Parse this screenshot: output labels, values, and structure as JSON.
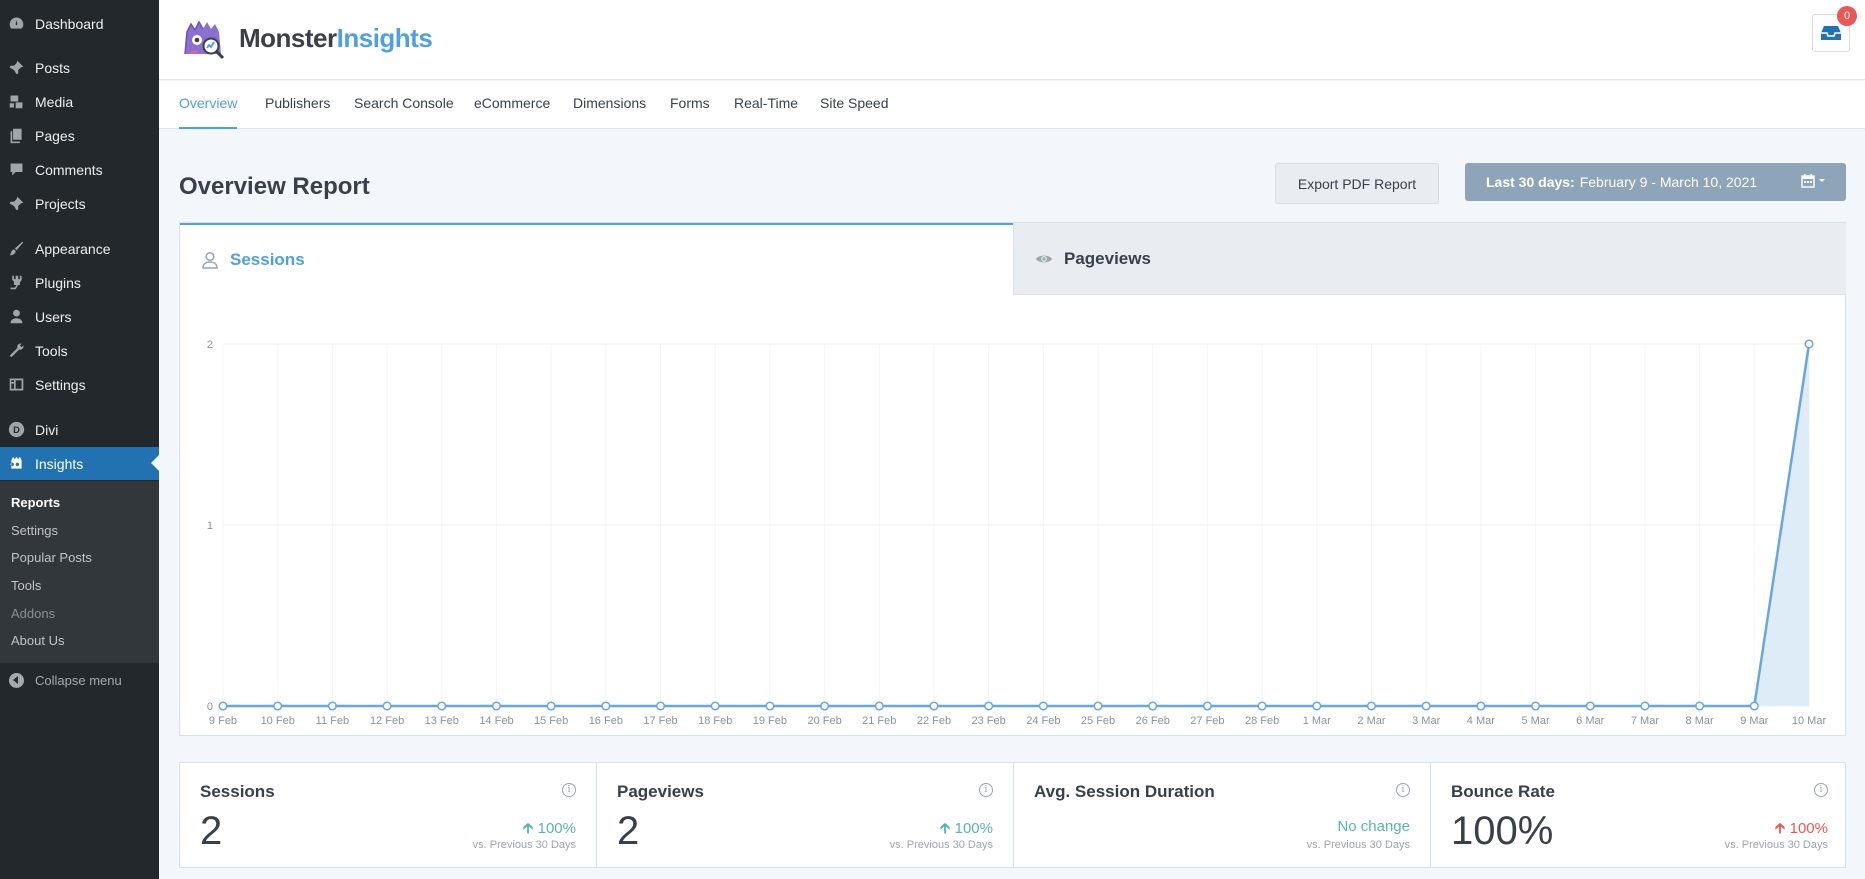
{
  "sidebar": {
    "items": [
      {
        "label": "Dashboard",
        "icon": "dashboard-icon"
      },
      {
        "label": "Posts",
        "icon": "pin-icon"
      },
      {
        "label": "Media",
        "icon": "media-icon"
      },
      {
        "label": "Pages",
        "icon": "pages-icon"
      },
      {
        "label": "Comments",
        "icon": "comment-icon"
      },
      {
        "label": "Projects",
        "icon": "pin-icon"
      },
      {
        "label": "Appearance",
        "icon": "brush-icon"
      },
      {
        "label": "Plugins",
        "icon": "plugin-icon"
      },
      {
        "label": "Users",
        "icon": "user-icon"
      },
      {
        "label": "Tools",
        "icon": "wrench-icon"
      },
      {
        "label": "Settings",
        "icon": "settings-icon"
      },
      {
        "label": "Divi",
        "icon": "divi-icon"
      },
      {
        "label": "Insights",
        "icon": "insights-icon"
      }
    ],
    "submenu": [
      "Reports",
      "Settings",
      "Popular Posts",
      "Tools",
      "Addons",
      "About Us"
    ],
    "collapse_label": "Collapse menu"
  },
  "header": {
    "logo_part1": "Monster",
    "logo_part2": "Insights",
    "notification_count": "0"
  },
  "nav": {
    "tabs": [
      "Overview",
      "Publishers",
      "Search Console",
      "eCommerce",
      "Dimensions",
      "Forms",
      "Real-Time",
      "Site Speed"
    ],
    "active": "Overview"
  },
  "report": {
    "title": "Overview Report",
    "export_label": "Export PDF Report",
    "date_label": "Last 30 days:",
    "date_range": "February 9 - March 10, 2021"
  },
  "chart_tabs": {
    "sessions": "Sessions",
    "pageviews": "Pageviews"
  },
  "chart_data": {
    "type": "area",
    "series": [
      {
        "values": [
          0,
          0,
          0,
          0,
          0,
          0,
          0,
          0,
          0,
          0,
          0,
          0,
          0,
          0,
          0,
          0,
          0,
          0,
          0,
          0,
          0,
          0,
          0,
          0,
          0,
          0,
          0,
          0,
          0,
          2,
          0
        ]
      }
    ],
    "x": [
      "9 Feb",
      "10 Feb",
      "11 Feb",
      "12 Feb",
      "13 Feb",
      "14 Feb",
      "15 Feb",
      "16 Feb",
      "17 Feb",
      "18 Feb",
      "19 Feb",
      "20 Feb",
      "21 Feb",
      "22 Feb",
      "23 Feb",
      "24 Feb",
      "25 Feb",
      "26 Feb",
      "27 Feb",
      "28 Feb",
      "1 Mar",
      "2 Mar",
      "3 Mar",
      "4 Mar",
      "5 Mar",
      "6 Mar",
      "7 Mar",
      "8 Mar",
      "9 Mar",
      "10 Mar"
    ],
    "y_ticks": [
      "0",
      "1",
      "2"
    ],
    "ylim": [
      0,
      2
    ],
    "colors": {
      "line": "#6ba5df",
      "fill": "#deecf8"
    }
  },
  "stats": [
    {
      "label": "Sessions",
      "value": "2",
      "change": "100%",
      "direction": "up",
      "compare": "vs. Previous 30 Days"
    },
    {
      "label": "Pageviews",
      "value": "2",
      "change": "100%",
      "direction": "up",
      "compare": "vs. Previous 30 Days"
    },
    {
      "label": "Avg. Session Duration",
      "value": "",
      "change": "No change",
      "direction": "same",
      "compare": "vs. Previous 30 Days"
    },
    {
      "label": "Bounce Rate",
      "value": "100%",
      "change": "100%",
      "direction": "down",
      "compare": "vs. Previous 30 Days"
    }
  ]
}
